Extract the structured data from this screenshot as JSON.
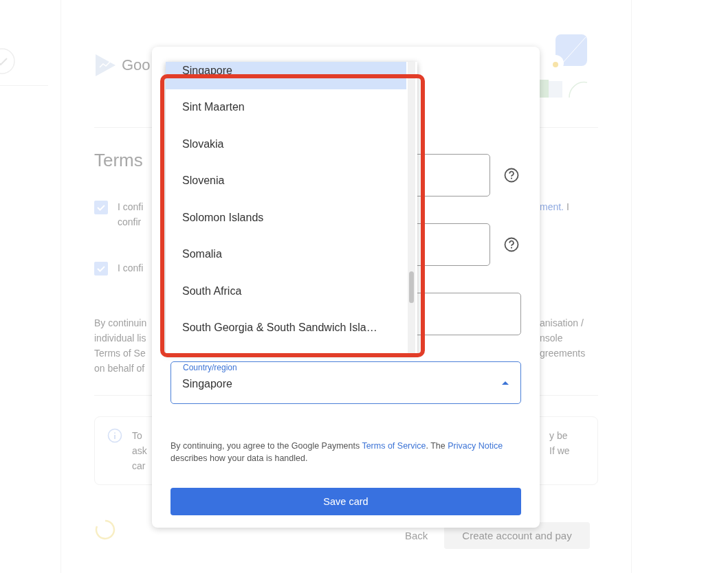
{
  "background": {
    "logo_text": "Goo",
    "heading": "Terms",
    "checkboxes": [
      {
        "checked": true,
        "lines": [
          "I confi",
          "confir"
        ],
        "right_link": "ment.",
        "right_text": "I"
      },
      {
        "checked": true,
        "lines": [
          "I confi"
        ]
      }
    ],
    "paragraph": {
      "left": [
        "By continuin",
        "individual lis",
        "Terms of Se",
        "on behalf of"
      ],
      "right": [
        "anisation /",
        "nsole",
        "greements"
      ]
    },
    "info": {
      "left": [
        "To",
        "ask",
        "car"
      ],
      "right": [
        "y be",
        "If we"
      ]
    },
    "back_label": "Back",
    "create_label": "Create account and pay"
  },
  "dialog": {
    "fields": [
      {
        "kind": "help"
      },
      {
        "kind": "help"
      },
      {
        "kind": "plain"
      },
      {
        "kind": "select",
        "label": "Country/region",
        "value": "Singapore",
        "expanded": true
      }
    ],
    "dropdown": {
      "items": [
        {
          "label": "Singapore",
          "selected": true
        },
        {
          "label": "Sint Maarten",
          "selected": false
        },
        {
          "label": "Slovakia",
          "selected": false
        },
        {
          "label": "Slovenia",
          "selected": false
        },
        {
          "label": "Solomon Islands",
          "selected": false
        },
        {
          "label": "Somalia",
          "selected": false
        },
        {
          "label": "South Africa",
          "selected": false
        },
        {
          "label": "South Georgia & South Sandwich Isla…",
          "selected": false
        }
      ]
    },
    "legal": {
      "before": "By continuing, you agree to the Google Payments ",
      "link1": "Terms of Service",
      "middle": ". The ",
      "link2": "Privacy Notice",
      "after": " describes how your data is handled."
    },
    "save_button": "Save card"
  }
}
